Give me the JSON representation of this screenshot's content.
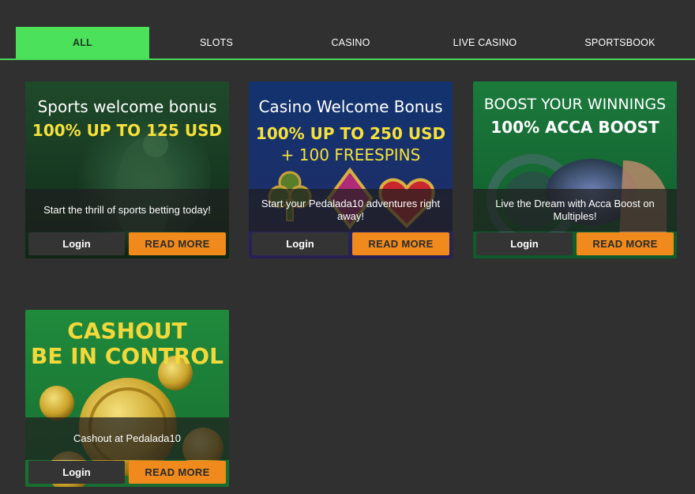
{
  "tabs": [
    {
      "label": "ALL",
      "active": true
    },
    {
      "label": "SLOTS",
      "active": false
    },
    {
      "label": "CASINO",
      "active": false
    },
    {
      "label": "LIVE CASINO",
      "active": false
    },
    {
      "label": "SPORTSBOOK",
      "active": false
    }
  ],
  "colors": {
    "background": "#303030",
    "accent_green": "#4be15b",
    "button_orange": "#f08a1c",
    "button_dark": "#343434",
    "title_yellow": "#f6e13a"
  },
  "promos": [
    {
      "title_line1": "Sports welcome bonus",
      "title_line2": "100% UP TO 125 USD",
      "caption": "Start the thrill of sports betting today!",
      "login_label": "Login",
      "readmore_label": "READ MORE"
    },
    {
      "title_line1": "Casino Welcome Bonus",
      "title_line2": "100% UP TO 250 USD",
      "title_line3": "+ 100 FREESPINS",
      "caption": "Start your Pedalada10 adventures right away!",
      "login_label": "Login",
      "readmore_label": "READ MORE"
    },
    {
      "title_line1": "BOOST YOUR WINNINGS",
      "title_line2": "100% ACCA BOOST",
      "caption": "Live the Dream with Acca Boost on Multiples!",
      "login_label": "Login",
      "readmore_label": "READ MORE"
    },
    {
      "title_line1": "CASHOUT",
      "title_line2": "BE IN CONTROL",
      "caption": "Cashout at Pedalada10",
      "login_label": "Login",
      "readmore_label": "READ MORE"
    }
  ]
}
